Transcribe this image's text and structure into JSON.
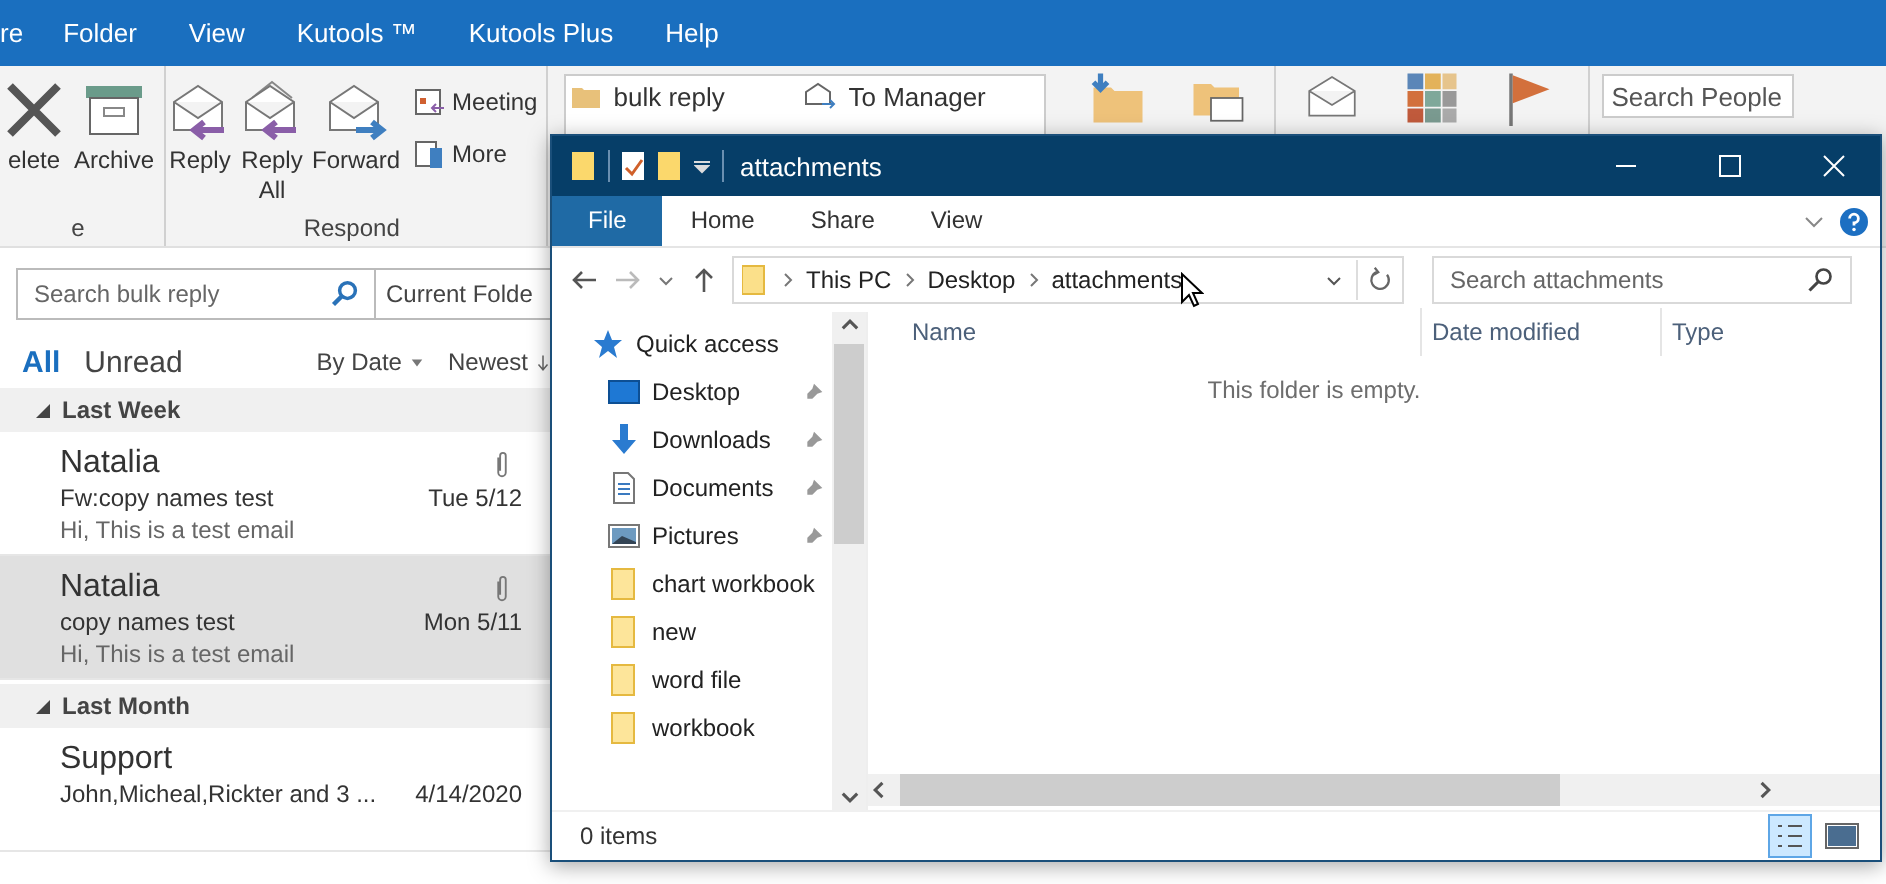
{
  "outlook": {
    "menu_tabs": [
      {
        "label": "re"
      },
      {
        "label": "Folder"
      },
      {
        "label": "View"
      },
      {
        "label": "Kutools ™"
      },
      {
        "label": "Kutools Plus"
      },
      {
        "label": "Help"
      }
    ],
    "ribbon_groups": [
      {
        "label": "e",
        "items": [
          {
            "kind": "large",
            "label": "elete"
          },
          {
            "kind": "large",
            "label": "Archive"
          }
        ]
      },
      {
        "label": "Respond",
        "items": [
          {
            "kind": "large",
            "label": "Reply"
          },
          {
            "kind": "large",
            "label": "Reply All"
          },
          {
            "kind": "large",
            "label": "Forward"
          },
          {
            "kind": "small",
            "label": "Meeting"
          },
          {
            "kind": "small",
            "label": "More"
          }
        ]
      }
    ],
    "quick_steps": [
      {
        "label": "bulk reply"
      },
      {
        "label": "To Manager"
      }
    ],
    "search_people": {
      "placeholder": "Search People"
    },
    "mail_search": {
      "placeholder": "Search bulk reply",
      "scope": "Current Folde"
    },
    "filters": [
      {
        "label": "All",
        "selected": true
      },
      {
        "label": "Unread",
        "selected": false
      }
    ],
    "sort": {
      "by": "By Date",
      "order": "Newest"
    },
    "groups": [
      {
        "label": "Last Week",
        "messages": [
          {
            "sender": "Natalia",
            "subject": "Fw:copy names test",
            "date": "Tue 5/12",
            "preview": "Hi,  This is a test email",
            "attachment": true,
            "selected": false
          },
          {
            "sender": "Natalia",
            "subject": "copy names test",
            "date": "Mon 5/11",
            "preview": "Hi,  This is a test email",
            "attachment": true,
            "selected": true
          }
        ]
      },
      {
        "label": "Last Month",
        "messages": [
          {
            "sender": "Support",
            "subject": "John,Micheal,Rickter and 3 ...",
            "date": "4/14/2020",
            "attachment": false,
            "selected": false
          }
        ]
      }
    ]
  },
  "explorer": {
    "title": "attachments",
    "tabs": [
      {
        "label": "File",
        "selected": true
      },
      {
        "label": "Home",
        "selected": false
      },
      {
        "label": "Share",
        "selected": false
      },
      {
        "label": "View",
        "selected": false
      }
    ],
    "path": [
      "This PC",
      "Desktop",
      "attachments"
    ],
    "search": {
      "placeholder": "Search attachments"
    },
    "nav": [
      {
        "label": "Quick access",
        "pinned": false
      },
      {
        "label": "Desktop",
        "pinned": true
      },
      {
        "label": "Downloads",
        "pinned": true
      },
      {
        "label": "Documents",
        "pinned": true
      },
      {
        "label": "Pictures",
        "pinned": true
      },
      {
        "label": "chart workbook",
        "pinned": false
      },
      {
        "label": "new",
        "pinned": false
      },
      {
        "label": "word file",
        "pinned": false
      },
      {
        "label": "workbook",
        "pinned": false
      }
    ],
    "columns": [
      "Name",
      "Date modified",
      "Type"
    ],
    "empty_message": "This folder is empty.",
    "status": "0 items"
  }
}
